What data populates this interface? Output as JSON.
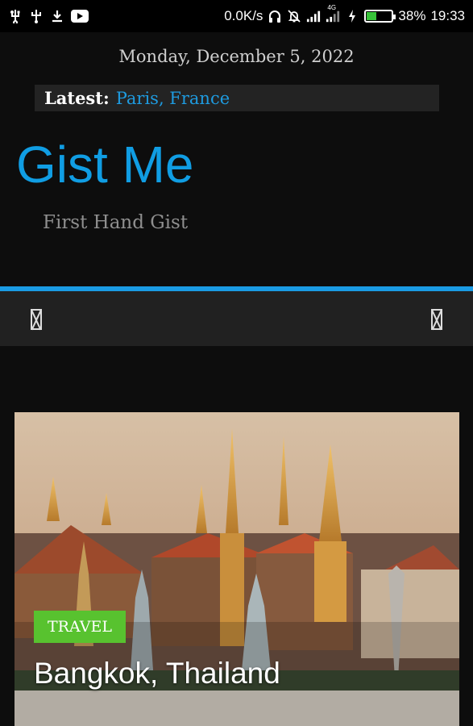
{
  "status_bar": {
    "network_speed": "0.0K/s",
    "network_type": "4G",
    "battery_percent": "38%",
    "battery_level": 0.38,
    "time": "19:33",
    "left_icons": [
      "usb-icon",
      "usb-icon",
      "download-icon",
      "youtube-icon"
    ],
    "right_icons": [
      "headphones-icon",
      "mute-icon",
      "signal-icon",
      "signal-icon",
      "charging-icon",
      "battery-icon"
    ]
  },
  "header": {
    "date": "Monday, December 5, 2022",
    "ticker_label": "Latest:",
    "ticker_link": "Paris, France",
    "site_title": "Gist Me",
    "site_tagline": "First Hand Gist"
  },
  "navbar": {
    "left_icon": "missing-glyph-icon",
    "right_icon": "missing-glyph-icon"
  },
  "featured_post": {
    "category": "TRAVEL",
    "title": "Bangkok, Thailand",
    "image_subject": "temple-photo"
  },
  "colors": {
    "accent": "#1a9be4",
    "badge": "#58c22f",
    "background": "#0d0d0d",
    "navbar": "#212121"
  }
}
